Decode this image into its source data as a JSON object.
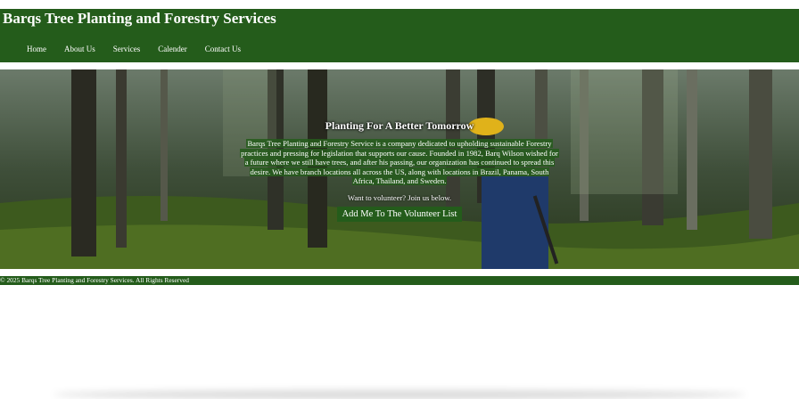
{
  "header": {
    "title": "Barqs Tree Planting and Forestry Services",
    "nav": [
      {
        "label": "Home"
      },
      {
        "label": "About Us"
      },
      {
        "label": "Services"
      },
      {
        "label": "Calender"
      },
      {
        "label": "Contact Us"
      }
    ]
  },
  "hero": {
    "title": "Planting For A Better Tomorrow",
    "description": "Barqs Tree Planting and Forestry Service is a company dedicated to upholding sustainable Forestry practices and pressing for legislation that supports our cause. Founded in 1982, Barq Wilson wished for a future where we still have trees, and after his passing, our organization has continued to spread this desire. We have branch locations all across the US, along with locations in Brazil, Panama, South Africa, Thailand, and Sweden.",
    "cta_text": "Want to volunteer? Join us below.",
    "button_label": "Add Me To The Volunteer List",
    "background_image": "forest-worker-photo"
  },
  "footer": {
    "text": "© 2025 Barqs Tree Planting and Forestry Services. All Rights Reserved"
  },
  "colors": {
    "brand_green": "#245c1b",
    "text": "#ffffff",
    "page_background": "#ffffff"
  }
}
